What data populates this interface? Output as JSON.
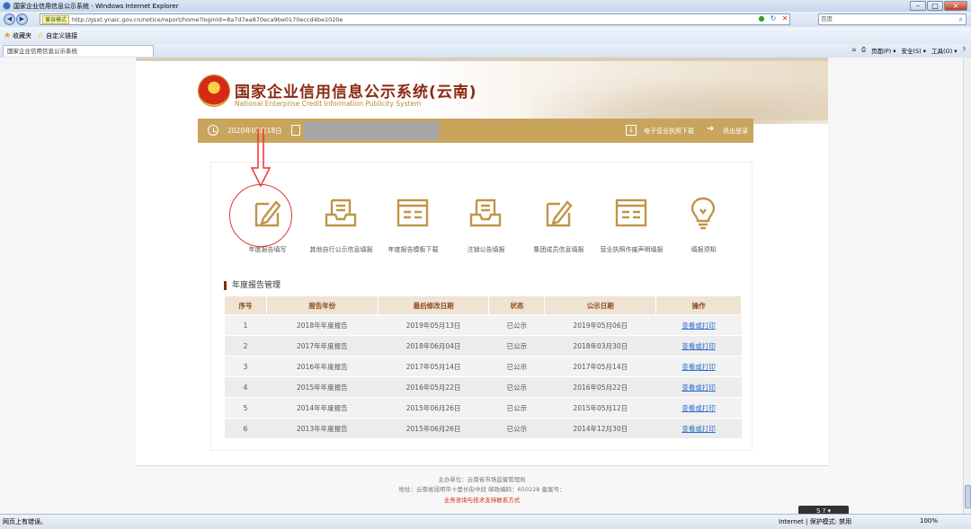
{
  "browser": {
    "window_title": "国家企业信用信息公示系统 - Windows Internet Explorer",
    "compat_label": "兼容模式",
    "url": "http://gsxt.ynaic.gov.cn/notice/report/home?loginId=8a7d7ea870eca9be0170eccd4be1020e",
    "search_placeholder": "百度",
    "favorites_label": "收藏夹",
    "custom_link_label": "自定义链接",
    "tab_title": "国家企业信用信息公示系统",
    "cmd_page": "页面(P) ▾",
    "cmd_safety": "安全(S) ▾",
    "cmd_tools": "工具(O) ▾",
    "status_text": "网页上有错误。",
    "zone_text": "Internet | 保护模式: 禁用",
    "zoom_text": "100%"
  },
  "header": {
    "title": "国家企业信用信息公示系统(云南)",
    "subtitle": "National Enterprise Credit Information Publicity System"
  },
  "topbar": {
    "date": "2020年03月18日",
    "download_label": "电子营业执照下载",
    "logout_label": "退出登录"
  },
  "tiles": [
    {
      "label": "年度报告填写",
      "icon": "edit-icon"
    },
    {
      "label": "其他自行公示信息填报",
      "icon": "tray-icon"
    },
    {
      "label": "年度报告模板下载",
      "icon": "template-icon"
    },
    {
      "label": "注销公告填报",
      "icon": "tray-icon"
    },
    {
      "label": "集团成员信息填报",
      "icon": "edit-icon"
    },
    {
      "label": "营业执照作废声明填报",
      "icon": "template-icon"
    },
    {
      "label": "填报须知",
      "icon": "lightbulb-icon"
    }
  ],
  "section_title": "年度报告管理",
  "table": {
    "headers": [
      "序号",
      "报告年份",
      "最后修改日期",
      "状态",
      "公示日期",
      "操作"
    ],
    "rows": [
      [
        "1",
        "2018年年度报告",
        "2019年05月13日",
        "已公示",
        "2019年05月06日",
        "查看或打印"
      ],
      [
        "2",
        "2017年年度报告",
        "2018年06月04日",
        "已公示",
        "2018年03月30日",
        "查看或打印"
      ],
      [
        "3",
        "2016年年度报告",
        "2017年05月14日",
        "已公示",
        "2017年05月14日",
        "查看或打印"
      ],
      [
        "4",
        "2015年年度报告",
        "2016年05月22日",
        "已公示",
        "2016年05月22日",
        "查看或打印"
      ],
      [
        "5",
        "2014年年度报告",
        "2015年06月26日",
        "已公示",
        "2015年05月12日",
        "查看或打印"
      ],
      [
        "6",
        "2013年年度报告",
        "2015年06月26日",
        "已公示",
        "2014年12月30日",
        "查看或打印"
      ]
    ]
  },
  "footer": {
    "line1": "主办单位：云南省市场监督管理局",
    "line2": "地址：云南省昆明市十里长街中段 邮政编码：650228 备案号：",
    "line3": "业务咨询与技术支持联系方式"
  },
  "colors": {
    "brand_red": "#8b2a12",
    "gold": "#c9a45d",
    "link": "#2a6fc9"
  }
}
